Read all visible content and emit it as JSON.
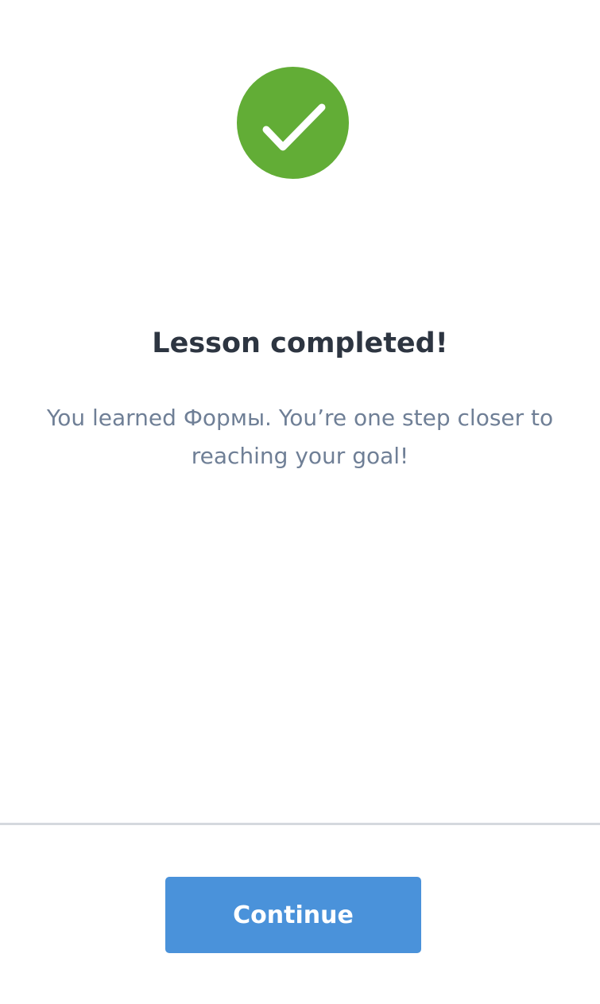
{
  "success": {
    "icon": "checkmark-icon",
    "color": "#62ad36"
  },
  "lesson": {
    "title": "Lesson completed!",
    "message": "You learned Формы. You’re one step closer to reaching your goal!"
  },
  "footer": {
    "continue_label": "Continue",
    "button_color": "#4a92da"
  }
}
